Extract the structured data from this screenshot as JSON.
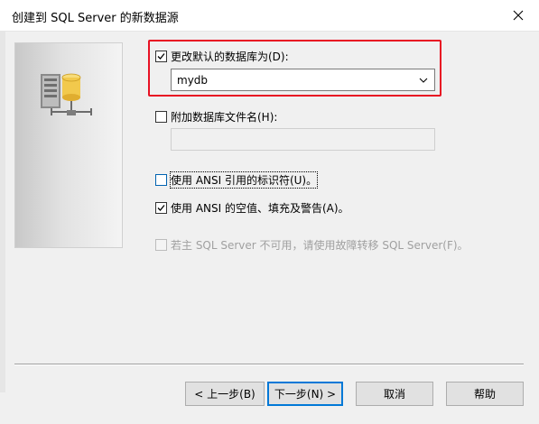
{
  "window": {
    "title": "创建到 SQL Server 的新数据源",
    "close_icon": "close-icon"
  },
  "image_panel": {
    "icon": "database-server-icon"
  },
  "options": {
    "change_default_db": {
      "label": "更改默认的数据库为(D):",
      "checked": true
    },
    "default_db_select": {
      "value": "mydb"
    },
    "attach_db_file": {
      "label": "附加数据库文件名(H):",
      "checked": false
    },
    "attach_db_file_input": {
      "value": ""
    },
    "ansi_quoted_identifiers": {
      "label": "使用 ANSI 引用的标识符(U)。",
      "checked": false
    },
    "ansi_nulls_padding_warnings": {
      "label": "使用 ANSI 的空值、填充及警告(A)。",
      "checked": true
    },
    "failover_server": {
      "label": "若主 SQL Server 不可用，请使用故障转移 SQL Server(F)。",
      "checked": false,
      "enabled": false
    }
  },
  "buttons": {
    "back": "< 上一步(B)",
    "next": "下一步(N) >",
    "cancel": "取消",
    "help": "帮助"
  },
  "colors": {
    "highlight": "#e81123",
    "default_button_border": "#0078d7",
    "database_cylinder": "#f2c94c"
  }
}
